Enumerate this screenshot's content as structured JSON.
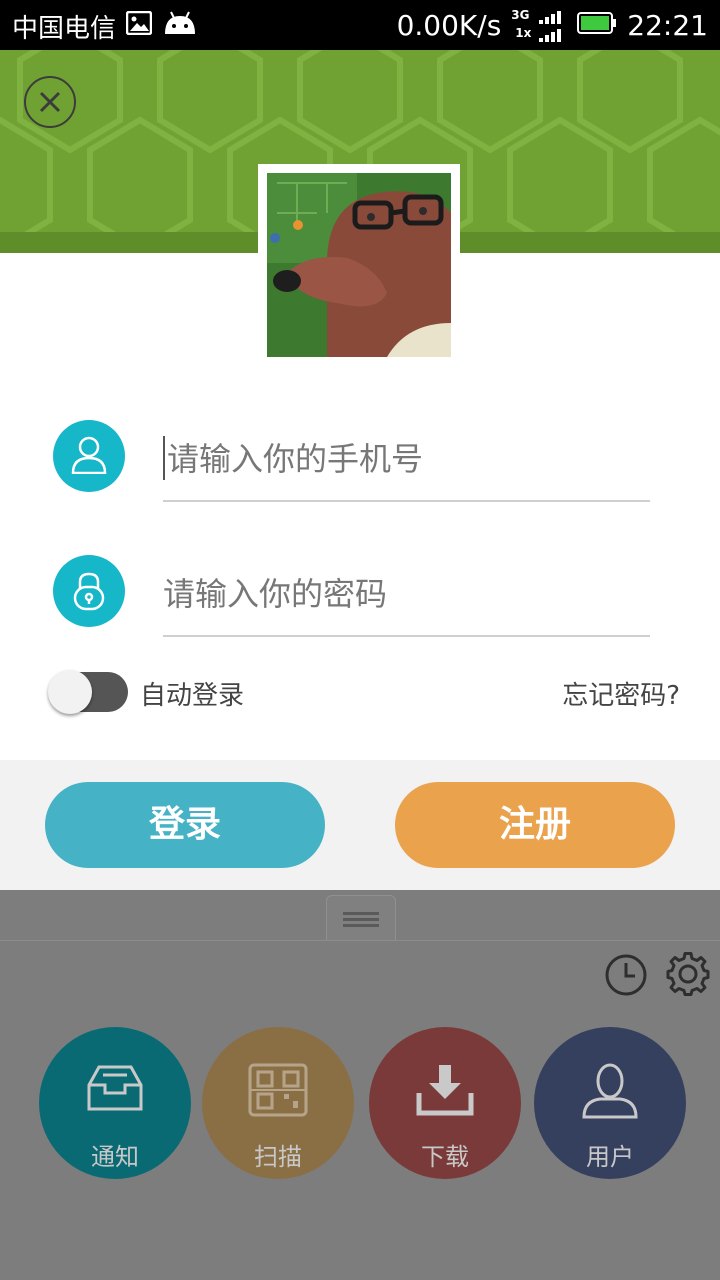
{
  "status_bar": {
    "carrier": "中国电信",
    "speed": "0.00K/s",
    "network_top": "3G",
    "network_bottom": "1x",
    "time": "22:21",
    "icons": [
      "image-icon",
      "android-icon",
      "signal-icon",
      "battery-icon"
    ]
  },
  "login": {
    "phone_placeholder": "请输入你的手机号",
    "password_placeholder": "请输入你的密码",
    "auto_login_label": "自动登录",
    "auto_login_on": false,
    "forgot_password": "忘记密码?",
    "login_button": "登录",
    "register_button": "注册"
  },
  "background_app": {
    "actions": [
      {
        "label": "通知",
        "icon": "inbox-icon",
        "color": "#0a6a74"
      },
      {
        "label": "扫描",
        "icon": "qr-code-icon",
        "color": "#8a6f45"
      },
      {
        "label": "下载",
        "icon": "download-icon",
        "color": "#7a3a39"
      },
      {
        "label": "用户",
        "icon": "user-icon",
        "color": "#35405e"
      }
    ],
    "toolbar_icons": [
      "clock-icon",
      "gear-icon"
    ]
  },
  "colors": {
    "accent_teal": "#15b7c9",
    "login_button": "#45b3c5",
    "register_button": "#eaa24d",
    "header_green": "#6fa232"
  }
}
